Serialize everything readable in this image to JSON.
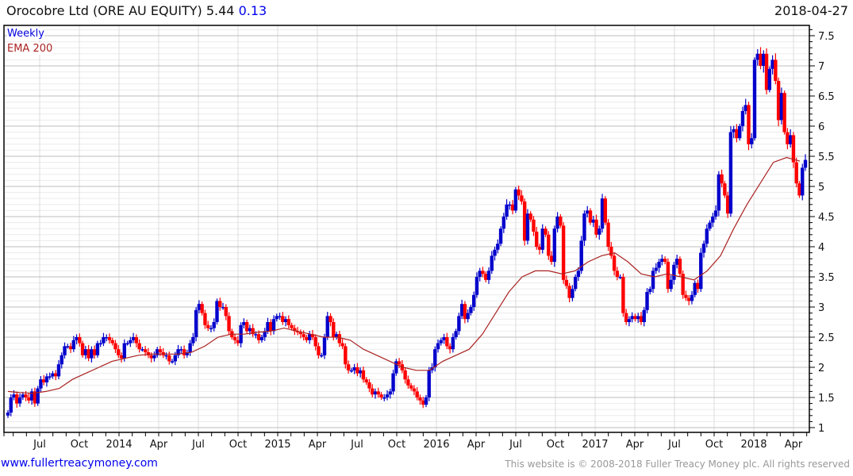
{
  "header": {
    "title": "Orocobre Ltd (ORE AU EQUITY) 5.44",
    "change": "0.13",
    "date": "2018-04-27"
  },
  "legend": {
    "interval": "Weekly",
    "ema": "EMA 200"
  },
  "footer": {
    "site": "www.fullertreacymoney.com",
    "copyright": "This website is © 2008-2018 Fuller Treacy Money plc. All rights reserved"
  },
  "colors": {
    "up": "#0000cc",
    "down": "#ff0000",
    "ema": "#aa2222",
    "accent": "#0000ee"
  },
  "chart_data": {
    "type": "candlestick",
    "interval": "weekly",
    "y_axis": {
      "side": "right",
      "range": [
        1,
        7.6
      ],
      "ticks": [
        "1",
        "1.5",
        "2",
        "2.5",
        "3",
        "3.5",
        "4",
        "4.5",
        "5",
        "5.5",
        "6",
        "6.5",
        "7",
        "7.5"
      ]
    },
    "x_axis": {
      "ticks": [
        "Jul",
        "Oct",
        "2014",
        "Apr",
        "Jul",
        "Oct",
        "2015",
        "Apr",
        "Jul",
        "Oct",
        "2016",
        "Apr",
        "Jul",
        "Oct",
        "2017",
        "Apr",
        "Jul",
        "Oct",
        "2018",
        "Apr"
      ]
    },
    "grid": true,
    "legend_position": "top-left",
    "weekly_closes_by_month": [
      {
        "month": "2013-04",
        "closes": [
          1.25,
          1.5
        ]
      },
      {
        "month": "2013-05",
        "closes": [
          1.55,
          1.4,
          1.5,
          1.55
        ]
      },
      {
        "month": "2013-06",
        "closes": [
          1.5,
          1.45,
          1.6
        ]
      },
      {
        "month": "2013-07",
        "closes": [
          1.4,
          1.65,
          1.8,
          1.75
        ]
      },
      {
        "month": "2013-08",
        "closes": [
          1.85,
          1.85,
          1.9,
          1.85,
          2.05
        ]
      },
      {
        "month": "2013-09",
        "closes": [
          2.2,
          2.35,
          2.35,
          2.3
        ]
      },
      {
        "month": "2013-10",
        "closes": [
          2.45,
          2.5,
          2.4,
          2.2,
          2.3
        ]
      },
      {
        "month": "2013-11",
        "closes": [
          2.15,
          2.3,
          2.2,
          2.4
        ]
      },
      {
        "month": "2013-12",
        "closes": [
          2.4,
          2.5,
          2.5,
          2.45,
          2.4
        ]
      },
      {
        "month": "2014-01",
        "closes": [
          2.3,
          2.2,
          2.15,
          2.4,
          2.4
        ]
      },
      {
        "month": "2014-02",
        "closes": [
          2.45,
          2.5,
          2.4,
          2.3
        ]
      },
      {
        "month": "2014-03",
        "closes": [
          2.3,
          2.25,
          2.2,
          2.15,
          2.2
        ]
      },
      {
        "month": "2014-04",
        "closes": [
          2.3,
          2.25,
          2.2,
          2.2
        ]
      },
      {
        "month": "2014-05",
        "closes": [
          2.1,
          2.1,
          2.2,
          2.3,
          2.3
        ]
      },
      {
        "month": "2014-06",
        "closes": [
          2.2,
          2.25,
          2.4,
          2.5
        ]
      },
      {
        "month": "2014-07",
        "closes": [
          2.95,
          3.05,
          2.9,
          2.7,
          2.65
        ]
      },
      {
        "month": "2014-08",
        "closes": [
          2.65,
          2.75,
          3.1,
          3.0
        ]
      },
      {
        "month": "2014-09",
        "closes": [
          3.0,
          2.85,
          2.6,
          2.5,
          2.45
        ]
      },
      {
        "month": "2014-10",
        "closes": [
          2.4,
          2.7,
          2.75,
          2.6
        ]
      },
      {
        "month": "2014-11",
        "closes": [
          2.65,
          2.55,
          2.55,
          2.45,
          2.5
        ]
      },
      {
        "month": "2014-12",
        "closes": [
          2.6,
          2.75,
          2.6,
          2.8,
          2.85
        ]
      },
      {
        "month": "2015-01",
        "closes": [
          2.85,
          2.75,
          2.8,
          2.7
        ]
      },
      {
        "month": "2015-02",
        "closes": [
          2.65,
          2.6,
          2.58,
          2.55
        ]
      },
      {
        "month": "2015-03",
        "closes": [
          2.5,
          2.45,
          2.55,
          2.5,
          2.35
        ]
      },
      {
        "month": "2015-04",
        "closes": [
          2.2,
          2.2,
          2.5,
          2.85
        ]
      },
      {
        "month": "2015-05",
        "closes": [
          2.75,
          2.5,
          2.55,
          2.4,
          2.35
        ]
      },
      {
        "month": "2015-06",
        "closes": [
          2.05,
          1.95,
          1.95,
          2.0
        ]
      },
      {
        "month": "2015-07",
        "closes": [
          1.9,
          1.95,
          1.8,
          1.75,
          1.65
        ]
      },
      {
        "month": "2015-08",
        "closes": [
          1.55,
          1.6,
          1.55,
          1.5
        ]
      },
      {
        "month": "2015-09",
        "closes": [
          1.5,
          1.55,
          1.6,
          1.9
        ]
      },
      {
        "month": "2015-10",
        "closes": [
          2.1,
          2.05,
          1.95,
          1.8,
          1.7
        ]
      },
      {
        "month": "2015-11",
        "closes": [
          1.65,
          1.6,
          1.5,
          1.45
        ]
      },
      {
        "month": "2015-12",
        "closes": [
          1.38,
          1.5,
          1.95,
          2.0
        ]
      },
      {
        "month": "2016-01",
        "closes": [
          2.3,
          2.4,
          2.45,
          2.5
        ]
      },
      {
        "month": "2016-02",
        "closes": [
          2.35,
          2.3,
          2.5,
          2.6
        ]
      },
      {
        "month": "2016-03",
        "closes": [
          2.85,
          3.05,
          2.8,
          2.9,
          3.0
        ]
      },
      {
        "month": "2016-04",
        "closes": [
          3.2,
          3.5,
          3.6,
          3.55
        ]
      },
      {
        "month": "2016-05",
        "closes": [
          3.45,
          3.6,
          3.85,
          3.95,
          4.05
        ]
      },
      {
        "month": "2016-06",
        "closes": [
          4.3,
          4.5,
          4.7,
          4.7
        ]
      },
      {
        "month": "2016-07",
        "closes": [
          4.6,
          4.95,
          4.85,
          4.75,
          4.1
        ]
      },
      {
        "month": "2016-08",
        "closes": [
          4.55,
          4.45,
          4.25,
          4.0
        ]
      },
      {
        "month": "2016-09",
        "closes": [
          3.95,
          4.3,
          4.2,
          3.85,
          3.75
        ]
      },
      {
        "month": "2016-10",
        "closes": [
          4.3,
          4.5,
          4.35,
          3.45
        ]
      },
      {
        "month": "2016-11",
        "closes": [
          3.35,
          3.15,
          3.3,
          3.5
        ]
      },
      {
        "month": "2016-12",
        "closes": [
          3.6,
          4.1,
          4.55,
          4.6,
          4.4
        ]
      },
      {
        "month": "2017-01",
        "closes": [
          4.45,
          4.2,
          4.3,
          4.8
        ]
      },
      {
        "month": "2017-02",
        "closes": [
          4.4,
          4.0,
          3.85,
          3.6
        ]
      },
      {
        "month": "2017-03",
        "closes": [
          3.5,
          3.5,
          2.9,
          2.75,
          2.8
        ]
      },
      {
        "month": "2017-04",
        "closes": [
          2.85,
          2.8,
          2.85,
          2.75
        ]
      },
      {
        "month": "2017-05",
        "closes": [
          2.95,
          3.25,
          3.3,
          3.6
        ]
      },
      {
        "month": "2017-06",
        "closes": [
          3.65,
          3.75,
          3.8,
          3.75,
          3.3
        ]
      },
      {
        "month": "2017-07",
        "closes": [
          3.45,
          3.7,
          3.8,
          3.55
        ]
      },
      {
        "month": "2017-08",
        "closes": [
          3.2,
          3.15,
          3.1,
          3.2,
          3.4
        ]
      },
      {
        "month": "2017-09",
        "closes": [
          3.3,
          3.9,
          4.05,
          4.3
        ]
      },
      {
        "month": "2017-10",
        "closes": [
          4.4,
          4.5,
          4.6,
          5.2
        ]
      },
      {
        "month": "2017-11",
        "closes": [
          5.05,
          4.85,
          4.55,
          5.9
        ]
      },
      {
        "month": "2017-12",
        "closes": [
          5.95,
          5.8,
          6.0,
          6.25,
          6.35
        ]
      },
      {
        "month": "2018-01",
        "closes": [
          5.7,
          5.8,
          7.1,
          7.2
        ]
      },
      {
        "month": "2018-02",
        "closes": [
          7.0,
          7.2,
          6.6,
          6.95
        ]
      },
      {
        "month": "2018-03",
        "closes": [
          7.1,
          6.75,
          6.1,
          6.55,
          5.9
        ]
      },
      {
        "month": "2018-04",
        "closes": [
          5.7,
          5.85,
          5.4,
          5.05,
          4.85,
          5.31,
          5.44
        ]
      }
    ],
    "ema200_by_month": [
      [
        "2013-04",
        1.6
      ],
      [
        "2013-05",
        1.58
      ],
      [
        "2013-06",
        1.57
      ],
      [
        "2013-07",
        1.6
      ],
      [
        "2013-08",
        1.65
      ],
      [
        "2013-09",
        1.8
      ],
      [
        "2013-10",
        1.9
      ],
      [
        "2013-11",
        2.0
      ],
      [
        "2013-12",
        2.1
      ],
      [
        "2014-01",
        2.15
      ],
      [
        "2014-02",
        2.2
      ],
      [
        "2014-03",
        2.22
      ],
      [
        "2014-04",
        2.22
      ],
      [
        "2014-05",
        2.22
      ],
      [
        "2014-06",
        2.25
      ],
      [
        "2014-07",
        2.35
      ],
      [
        "2014-08",
        2.5
      ],
      [
        "2014-09",
        2.55
      ],
      [
        "2014-10",
        2.55
      ],
      [
        "2014-11",
        2.58
      ],
      [
        "2014-12",
        2.6
      ],
      [
        "2015-01",
        2.65
      ],
      [
        "2015-02",
        2.6
      ],
      [
        "2015-03",
        2.55
      ],
      [
        "2015-04",
        2.5
      ],
      [
        "2015-05",
        2.5
      ],
      [
        "2015-06",
        2.45
      ],
      [
        "2015-07",
        2.3
      ],
      [
        "2015-08",
        2.2
      ],
      [
        "2015-09",
        2.1
      ],
      [
        "2015-10",
        2.0
      ],
      [
        "2015-11",
        1.95
      ],
      [
        "2015-12",
        1.95
      ],
      [
        "2016-01",
        2.1
      ],
      [
        "2016-02",
        2.2
      ],
      [
        "2016-03",
        2.3
      ],
      [
        "2016-04",
        2.55
      ],
      [
        "2016-05",
        2.9
      ],
      [
        "2016-06",
        3.25
      ],
      [
        "2016-07",
        3.5
      ],
      [
        "2016-08",
        3.6
      ],
      [
        "2016-09",
        3.6
      ],
      [
        "2016-10",
        3.55
      ],
      [
        "2016-11",
        3.6
      ],
      [
        "2016-12",
        3.75
      ],
      [
        "2017-01",
        3.85
      ],
      [
        "2017-02",
        3.9
      ],
      [
        "2017-03",
        3.75
      ],
      [
        "2017-04",
        3.55
      ],
      [
        "2017-05",
        3.5
      ],
      [
        "2017-06",
        3.55
      ],
      [
        "2017-07",
        3.5
      ],
      [
        "2017-08",
        3.45
      ],
      [
        "2017-09",
        3.6
      ],
      [
        "2017-10",
        3.85
      ],
      [
        "2017-11",
        4.3
      ],
      [
        "2017-12",
        4.7
      ],
      [
        "2018-01",
        5.05
      ],
      [
        "2018-02",
        5.4
      ],
      [
        "2018-03",
        5.48
      ],
      [
        "2018-04",
        5.42
      ]
    ]
  }
}
